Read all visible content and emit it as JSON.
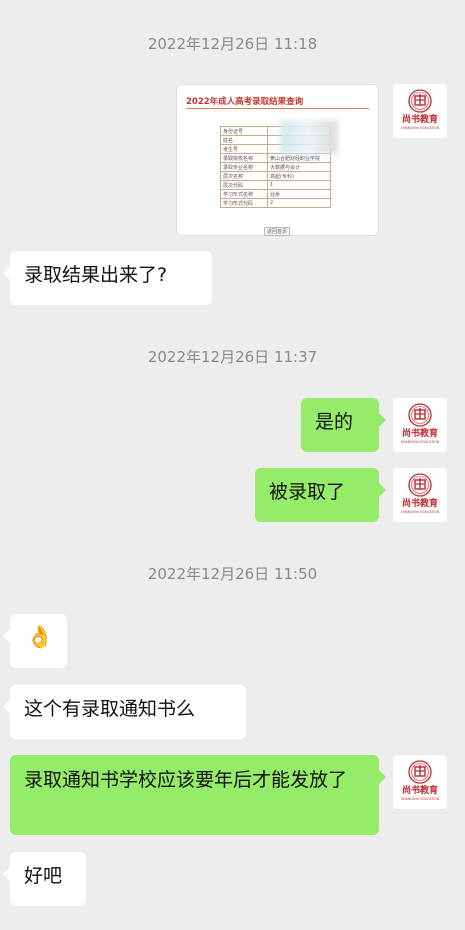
{
  "timestamps": [
    "2022年12月26日 11:18",
    "2022年12月26日 11:37",
    "2022年12月26日 11:50"
  ],
  "image_message": {
    "title": "2022年成人高考录取结果查询",
    "rows": [
      {
        "k": "身份证号",
        "v": ""
      },
      {
        "k": "姓名",
        "v": ""
      },
      {
        "k": "考生号",
        "v": ""
      },
      {
        "k": "录取院校名称",
        "v": "黄山合肥财经职业学院"
      },
      {
        "k": "录取专业名称",
        "v": "大数据与会计"
      },
      {
        "k": "层次名称",
        "v": "高起(专科)"
      },
      {
        "k": "层次代码",
        "v": "1"
      },
      {
        "k": "学习形式名称",
        "v": "业余"
      },
      {
        "k": "学习形式代码",
        "v": "2"
      }
    ],
    "button": "返回首页"
  },
  "messages": {
    "m1": "录取结果出来了?",
    "m2": "是的",
    "m3": "被录取了",
    "m4": "👌",
    "m5": "这个有录取通知书么",
    "m6": "录取通知书学校应该要年后才能发放了",
    "m7": "好吧"
  },
  "avatar": {
    "brand": "尚书教育",
    "sub": "SHANGSHU EDUCATION",
    "color": "#c0282d"
  }
}
